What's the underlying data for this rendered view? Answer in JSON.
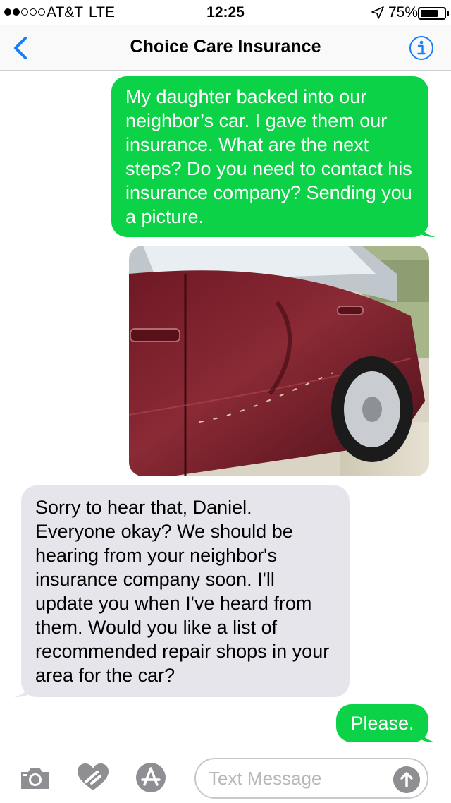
{
  "status_bar": {
    "carrier": "AT&T",
    "network": "LTE",
    "time": "12:25",
    "battery_percent": "75%",
    "battery_level": 0.75,
    "signal_bars_filled": 2,
    "signal_bars_total": 5
  },
  "nav": {
    "title": "Choice Care Insurance",
    "back_icon": "chevron-left-icon",
    "info_icon": "info-icon"
  },
  "messages": [
    {
      "direction": "sent",
      "text": "My daughter backed into our neighbor’s car. I gave them our insurance. What are the next steps? Do you need to contact his insurance company? Sending you a picture."
    },
    {
      "direction": "sent",
      "type": "image",
      "image_desc": "car-damage-photo"
    },
    {
      "direction": "received",
      "text": "Sorry to hear that, Daniel. Everyone okay? We should be hearing from your neighbor's insurance company soon. I'll update you when I've heard from them. Would you like a list of recommended repair shops in your area for the car?"
    },
    {
      "direction": "sent",
      "text": "Please."
    }
  ],
  "input": {
    "placeholder": "Text Message",
    "value": ""
  },
  "colors": {
    "sent_bubble": "#0bd246",
    "received_bubble": "#e6e5eb",
    "accent": "#147efb",
    "toolbar_icon": "#8e8e93"
  }
}
